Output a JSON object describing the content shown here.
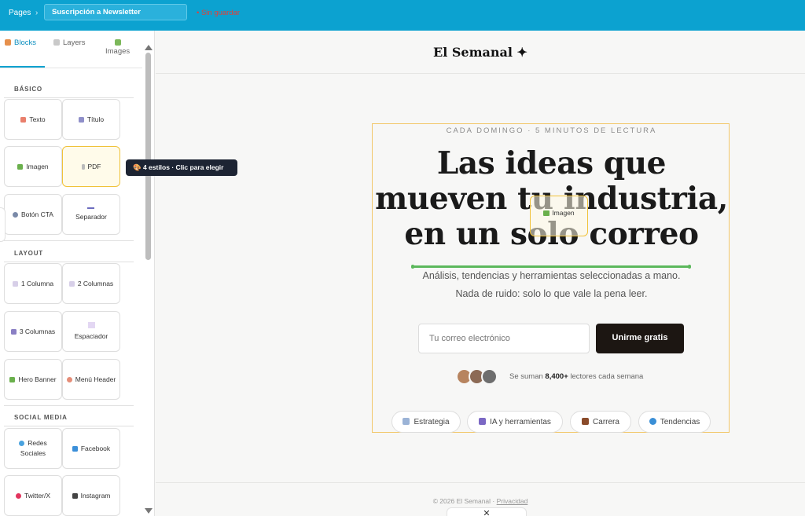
{
  "topbar": {
    "breadcrumb": "Pages",
    "breadcrumb_sep": "›",
    "page_name": "Suscripción a Newsletter",
    "unsaved": "• Sin guardar"
  },
  "sidebar": {
    "tabs": [
      {
        "label": "Blocks",
        "icon": "blocks-icon",
        "active": true
      },
      {
        "label": "Layers",
        "icon": "layers-icon",
        "active": false
      },
      {
        "label": "Images",
        "icon": "image-icon",
        "active": false
      }
    ],
    "sections": [
      {
        "title": "BÁSICO",
        "blocks": [
          {
            "label": "Texto",
            "icon": "text-icon"
          },
          {
            "label": "Título",
            "icon": "title-icon"
          },
          {
            "label": "Imagen",
            "icon": "image-icon"
          },
          {
            "label": "PDF",
            "icon": "pdf-icon"
          },
          {
            "label": "Botón CTA",
            "icon": "button-icon"
          },
          {
            "label": "Separador",
            "icon": "separator-icon"
          }
        ]
      },
      {
        "title": "LAYOUT",
        "blocks": [
          {
            "label": "1 Columna",
            "icon": "one-column-icon"
          },
          {
            "label": "2 Columnas",
            "icon": "two-columns-icon"
          },
          {
            "label": "3 Columnas",
            "icon": "three-columns-icon"
          },
          {
            "label": "Espaciador",
            "icon": "spacer-icon"
          },
          {
            "label": "Hero Banner",
            "icon": "hero-icon"
          },
          {
            "label": "Menú Header",
            "icon": "menu-icon"
          }
        ]
      },
      {
        "title": "SOCIAL MEDIA",
        "blocks": [
          {
            "label": "Redes Sociales",
            "icon": "globe-icon"
          },
          {
            "label": "Facebook",
            "icon": "facebook-icon"
          },
          {
            "label": "Twitter/X",
            "icon": "twitter-icon"
          },
          {
            "label": "Instagram",
            "icon": "instagram-icon"
          }
        ]
      }
    ]
  },
  "tooltip": "🎨 4 estilos · Clic para elegir",
  "canvas": {
    "logo": "El Semanal ✦",
    "kicker": "CADA DOMINGO · 5 MINUTOS DE LECTURA",
    "headline": "Las ideas que mueven tu industria, en un solo correo",
    "drag_ghost": "Imagen",
    "sub1": "Análisis, tendencias y herramientas seleccionadas a mano.",
    "sub2": "Nada de ruido: solo lo que vale la pena leer.",
    "email_placeholder": "Tu correo electrónico",
    "cta": "Unirme gratis",
    "social_pre": "Se suman",
    "social_count": "8,400+",
    "social_post": "lectores cada semana",
    "chips": [
      {
        "label": "Estrategia",
        "icon": "chart-icon"
      },
      {
        "label": "IA y herramientas",
        "icon": "robot-icon"
      },
      {
        "label": "Carrera",
        "icon": "briefcase-icon"
      },
      {
        "label": "Tendencias",
        "icon": "globe-icon"
      }
    ],
    "footer_text": "© 2026 El Semanal ·",
    "footer_link": "Privacidad"
  },
  "bottom_panel": "✕",
  "colors": {
    "topbar": "#0ca2d0",
    "accent": "#f0c23a",
    "cta": "#1c1612",
    "green_line": "#5cb85c"
  }
}
